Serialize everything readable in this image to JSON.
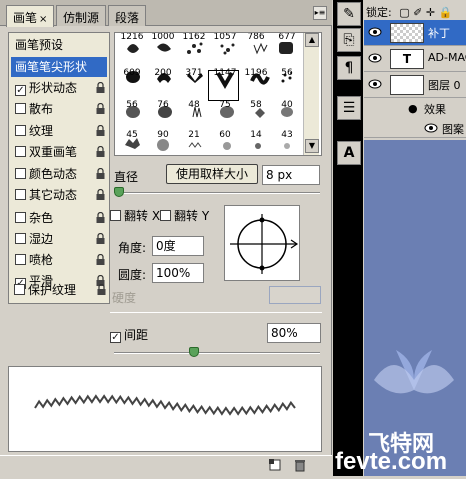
{
  "tabs": [
    {
      "label": "画笔",
      "close": "×",
      "active": true
    },
    {
      "label": "仿制源",
      "active": false
    },
    {
      "label": "段落",
      "active": false
    }
  ],
  "left_list": [
    {
      "label": "画笔预设",
      "checkbox": false,
      "checked": false,
      "lock": false
    },
    {
      "label": "画笔笔尖形状",
      "checkbox": false,
      "checked": false,
      "lock": false,
      "selected": true
    },
    {
      "label": "形状动态",
      "checkbox": true,
      "checked": true,
      "lock": true
    },
    {
      "label": "散布",
      "checkbox": true,
      "checked": false,
      "lock": true
    },
    {
      "label": "纹理",
      "checkbox": true,
      "checked": false,
      "lock": true
    },
    {
      "label": "双重画笔",
      "checkbox": true,
      "checked": false,
      "lock": true
    },
    {
      "label": "颜色动态",
      "checkbox": true,
      "checked": false,
      "lock": true
    },
    {
      "label": "其它动态",
      "checkbox": true,
      "checked": false,
      "lock": true
    },
    {
      "label": "杂色",
      "checkbox": true,
      "checked": false,
      "lock": true
    },
    {
      "label": "湿边",
      "checkbox": true,
      "checked": false,
      "lock": true
    },
    {
      "label": "喷枪",
      "checkbox": true,
      "checked": false,
      "lock": true
    },
    {
      "label": "平滑",
      "checkbox": true,
      "checked": true,
      "lock": true
    },
    {
      "label": "保护纹理",
      "checkbox": true,
      "checked": false,
      "lock": true
    }
  ],
  "brush_grid": {
    "top_numbers": [
      "1216",
      "1000",
      "1162",
      "1057",
      "786",
      "677"
    ],
    "rows": [
      [
        "609",
        "200",
        "371",
        "1147",
        "1196",
        "56"
      ],
      [
        "56",
        "76",
        "48",
        "75",
        "58",
        "40"
      ],
      [
        "45",
        "90",
        "21",
        "60",
        "14",
        "43"
      ]
    ]
  },
  "diameter": {
    "label": "直径",
    "button": "使用取样大小",
    "value": "8 px"
  },
  "flip": {
    "x_label": "翻转 X",
    "y_label": "翻转 Y"
  },
  "angle": {
    "label": "角度:",
    "value": "0度"
  },
  "roundness": {
    "label": "圆度:",
    "value": "100%"
  },
  "hardness": {
    "label": "硬度",
    "value": ""
  },
  "spacing": {
    "label": "间距",
    "value": "80%",
    "checked": true
  },
  "check_mark": "✓",
  "layers": {
    "lock_label": "锁定:",
    "rows": [
      {
        "name": "补丁",
        "selected": true,
        "thumb": "checker"
      },
      {
        "name": "AD-MAC",
        "selected": false,
        "thumb": "T"
      },
      {
        "name": "图层 0",
        "selected": false,
        "thumb": "white"
      }
    ],
    "effects_label": "效果",
    "effect_item": "图案"
  },
  "watermark": {
    "text1": "飞特网",
    "text2": "fevte.com"
  },
  "colors": {
    "accent": "#316ac5",
    "panel": "#d4d0c8",
    "list_bg": "#ece9d8"
  }
}
